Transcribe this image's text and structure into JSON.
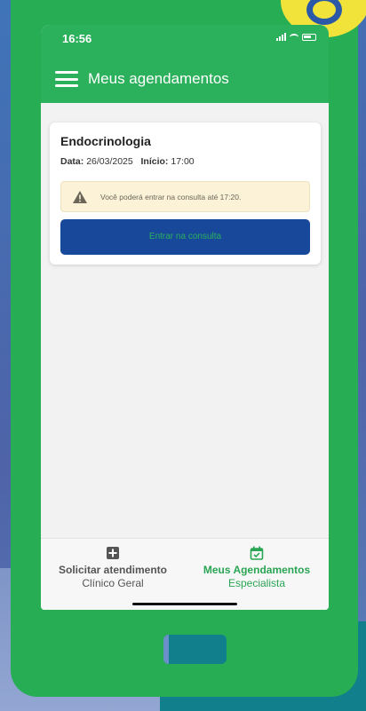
{
  "status_bar": {
    "time": "16:56"
  },
  "header": {
    "title": "Meus agendamentos"
  },
  "appointment": {
    "specialty": "Endocrinologia",
    "date_label": "Data:",
    "date_value": "26/03/2025",
    "start_label": "Início:",
    "start_value": "17:00",
    "warning": "Você poderá entrar na consulta até 17:20.",
    "enter_button": "Entrar na consulta"
  },
  "bottom_nav": {
    "left": {
      "label": "Solicitar atendimento",
      "sub": "Clínico Geral",
      "icon": "plus-square-icon"
    },
    "right": {
      "label": "Meus Agendamentos",
      "sub": "Especialista",
      "icon": "calendar-check-icon",
      "active": true
    }
  },
  "colors": {
    "brand_green": "#2bb05b",
    "button_blue": "#17489a",
    "warning_bg": "#fbf2d8"
  }
}
